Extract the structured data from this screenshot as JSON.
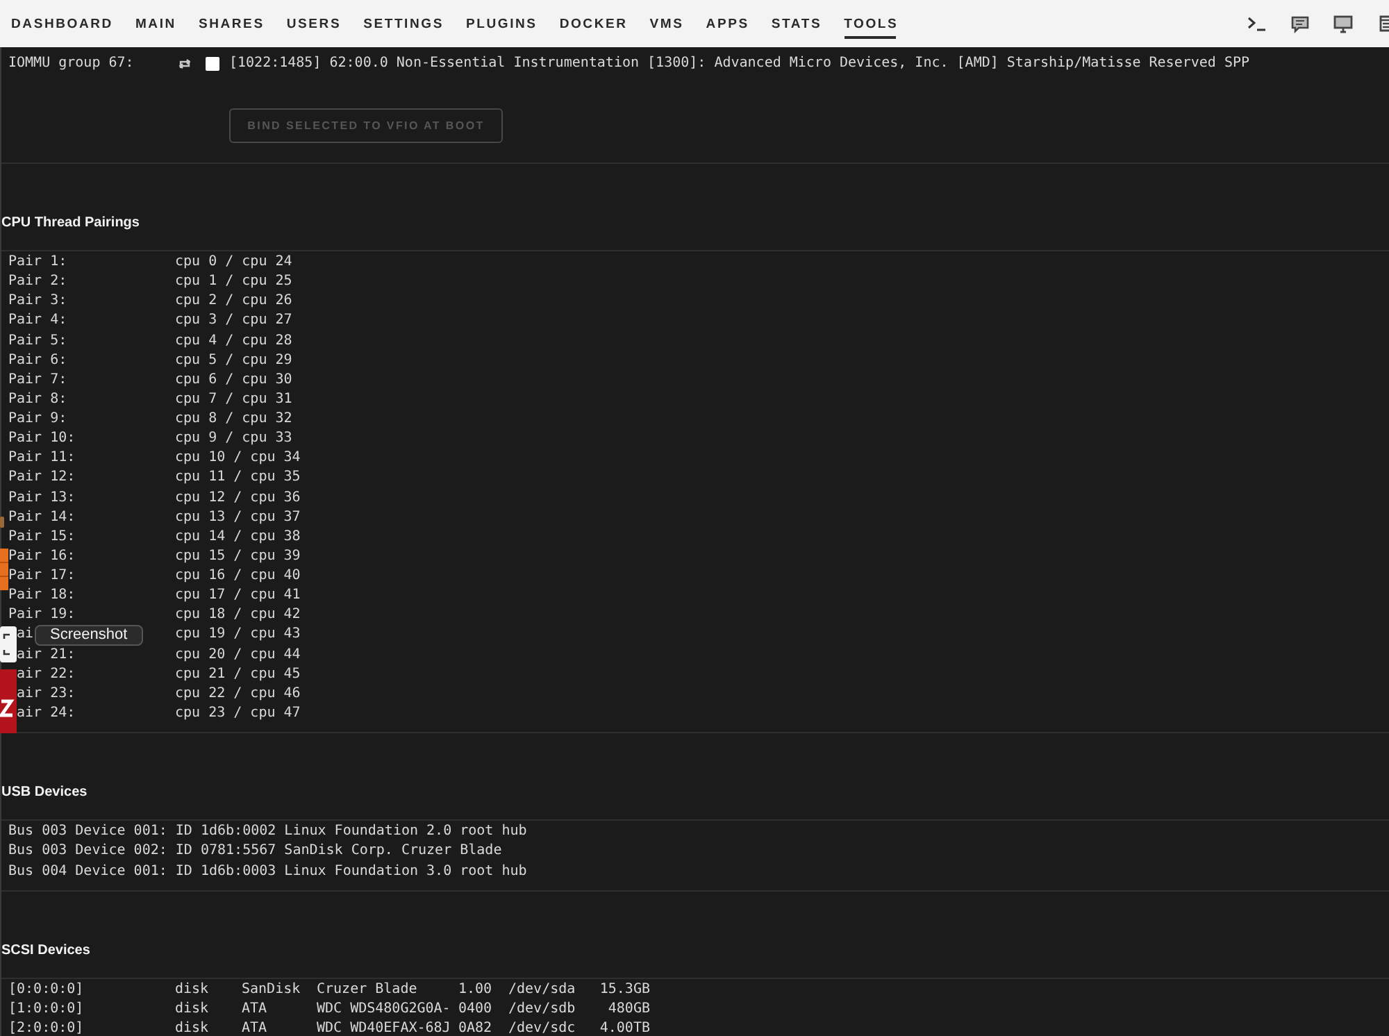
{
  "nav": {
    "items": [
      {
        "label": "DASHBOARD",
        "selected": false
      },
      {
        "label": "MAIN",
        "selected": false
      },
      {
        "label": "SHARES",
        "selected": false
      },
      {
        "label": "USERS",
        "selected": false
      },
      {
        "label": "SETTINGS",
        "selected": false
      },
      {
        "label": "PLUGINS",
        "selected": false
      },
      {
        "label": "DOCKER",
        "selected": false
      },
      {
        "label": "VMS",
        "selected": false
      },
      {
        "label": "APPS",
        "selected": false
      },
      {
        "label": "STATS",
        "selected": false
      },
      {
        "label": "TOOLS",
        "selected": true
      }
    ]
  },
  "iommu": {
    "group": "IOMMU group 67:",
    "checked": false,
    "device": "[1022:1485] 62:00.0 Non-Essential Instrumentation [1300]: Advanced Micro Devices, Inc. [AMD] Starship/Matisse Reserved SPP",
    "button": {
      "label": "BIND SELECTED TO VFIO AT BOOT",
      "disabled": true
    }
  },
  "sections": [
    {
      "kind": "pairs",
      "title": "CPU Thread Pairings",
      "rows": [
        {
          "label": "Pair 1:",
          "value": "cpu 0 / cpu 24",
          "obscured": false
        },
        {
          "label": "Pair 2:",
          "value": "cpu 1 / cpu 25",
          "obscured": false
        },
        {
          "label": "Pair 3:",
          "value": "cpu 2 / cpu 26",
          "obscured": false
        },
        {
          "label": "Pair 4:",
          "value": "cpu 3 / cpu 27",
          "obscured": false
        },
        {
          "label": "Pair 5:",
          "value": "cpu 4 / cpu 28",
          "obscured": false
        },
        {
          "label": "Pair 6:",
          "value": "cpu 5 / cpu 29",
          "obscured": false
        },
        {
          "label": "Pair 7:",
          "value": "cpu 6 / cpu 30",
          "obscured": false
        },
        {
          "label": "Pair 8:",
          "value": "cpu 7 / cpu 31",
          "obscured": false
        },
        {
          "label": "Pair 9:",
          "value": "cpu 8 / cpu 32",
          "obscured": false
        },
        {
          "label": "Pair 10:",
          "value": "cpu 9 / cpu 33",
          "obscured": false
        },
        {
          "label": "Pair 11:",
          "value": "cpu 10 / cpu 34",
          "obscured": false
        },
        {
          "label": "Pair 12:",
          "value": "cpu 11 / cpu 35",
          "obscured": false
        },
        {
          "label": "Pair 13:",
          "value": "cpu 12 / cpu 36",
          "obscured": false
        },
        {
          "label": "Pair 14:",
          "value": "cpu 13 / cpu 37",
          "obscured": false
        },
        {
          "label": "Pair 15:",
          "value": "cpu 14 / cpu 38",
          "obscured": false
        },
        {
          "label": "Pair 16:",
          "value": "cpu 15 / cpu 39",
          "obscured": false
        },
        {
          "label": "Pair 17:",
          "value": "cpu 16 / cpu 40",
          "obscured": false
        },
        {
          "label": "Pair 18:",
          "value": "cpu 17 / cpu 41",
          "obscured": false
        },
        {
          "label": "Pair 19:",
          "value": "cpu 18 / cpu 42",
          "obscured": false
        },
        {
          "label": "ai",
          "value": "cpu 19 / cpu 43",
          "obscured": true
        },
        {
          "label": "air 21:",
          "value": "cpu 20 / cpu 44",
          "obscured": true
        },
        {
          "label": "air 22:",
          "value": "cpu 21 / cpu 45",
          "obscured": true
        },
        {
          "label": "air 23:",
          "value": "cpu 22 / cpu 46",
          "obscured": true
        },
        {
          "label": "air 24:",
          "value": "cpu 23 / cpu 47",
          "obscured": true
        }
      ]
    },
    {
      "kind": "lines",
      "title": "USB Devices",
      "rows": [
        "Bus 003 Device 001: ID 1d6b:0002 Linux Foundation 2.0 root hub",
        "Bus 003 Device 002: ID 0781:5567 SanDisk Corp. Cruzer Blade",
        "Bus 004 Device 001: ID 1d6b:0003 Linux Foundation 3.0 root hub"
      ]
    },
    {
      "kind": "columns",
      "title": "SCSI Devices",
      "rows": [
        [
          "[0:0:0:0]",
          "disk",
          "SanDisk",
          "Cruzer Blade",
          "1.00",
          "/dev/sda",
          "15.3GB"
        ],
        [
          "[1:0:0:0]",
          "disk",
          "ATA",
          "WDC WDS480G2G0A-",
          "0400",
          "/dev/sdb",
          "480GB"
        ],
        [
          "[2:0:0:0]",
          "disk",
          "ATA",
          "WDC WD40EFAX-68J",
          "0A82",
          "/dev/sdc",
          "4.00TB"
        ]
      ]
    }
  ],
  "dock": {
    "tooltip": "Screenshot"
  }
}
